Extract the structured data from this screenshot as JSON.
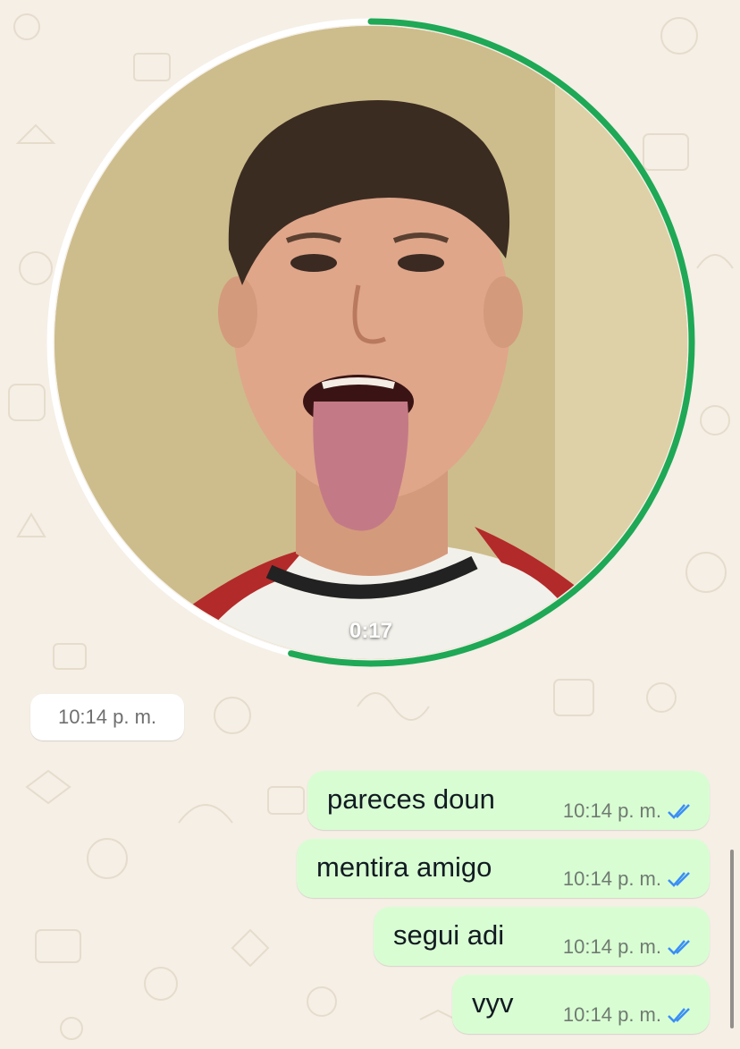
{
  "video_note": {
    "duration": "0:17",
    "progress": 0.54,
    "ring_color": "#1fa855",
    "alt_description_icon": "video-note"
  },
  "incoming": {
    "time": "10:14 p. m."
  },
  "outgoing": [
    {
      "text": "pareces doun",
      "time": "10:14 p. m.",
      "status": "read"
    },
    {
      "text": "mentira amigo",
      "time": "10:14 p. m.",
      "status": "read"
    },
    {
      "text": "segui adi",
      "time": "10:14 p. m.",
      "status": "read"
    },
    {
      "text": "vyv",
      "time": "10:14 p. m.",
      "status": "read"
    }
  ],
  "colors": {
    "background": "#f5efe6",
    "outgoing_bubble": "#d9fdd3",
    "incoming_bubble": "#ffffff",
    "read_ticks": "#3a8ef6",
    "accent": "#1fa855"
  }
}
